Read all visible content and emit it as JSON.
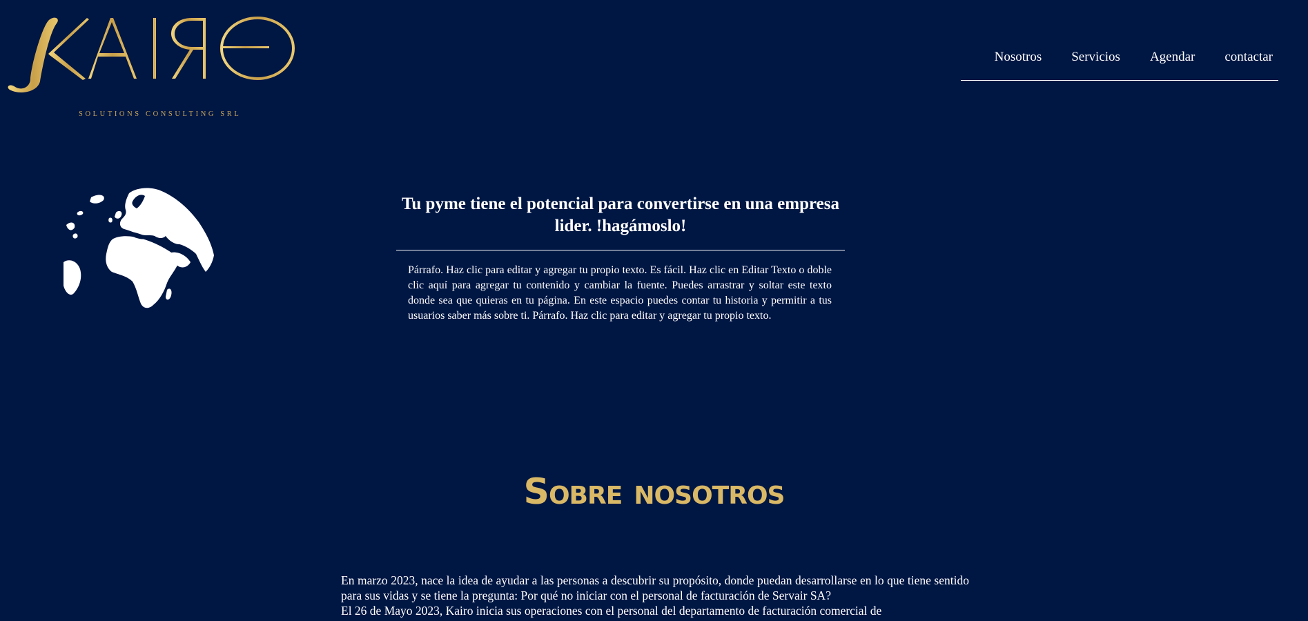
{
  "brand": {
    "logo_text": "KAIRO",
    "tagline": "SOLUTIONS CONSULTING SRL",
    "gold_color": "#c9a85a"
  },
  "nav": {
    "items": [
      {
        "label": "Nosotros"
      },
      {
        "label": "Servicios"
      },
      {
        "label": "Agendar"
      },
      {
        "label": "contactar"
      }
    ]
  },
  "hero": {
    "icon": "globe-icon",
    "title": "Tu pyme tiene el potencial para convertirse en una empresa lider. !hagámoslo!",
    "paragraph": "Párrafo. Haz clic para editar y agregar tu propio texto. Es fácil. Haz clic en Editar Texto o doble clic aquí para agregar tu contenido y cambiar la fuente. Puedes arrastrar y soltar este texto donde sea que quieras en tu página. En este espacio puedes contar tu historia y permitir a tus usuarios saber más sobre ti. Párrafo. Haz clic para editar y agregar tu propio texto."
  },
  "about": {
    "title": "Sobre nosotros",
    "paragraph_1": "En marzo 2023, nace la idea de ayudar a las personas a descubrir su propósito, donde puedan desarrollarse en lo que tiene sentido para sus vidas y se tiene la pregunta: Por qué no iniciar con el personal de facturación de Servair SA?",
    "paragraph_2": "El 26 de Mayo 2023, Kairo inicia sus operaciones con el personal del departamento de facturación comercial de"
  },
  "colors": {
    "background": "#001643",
    "accent_gold": "#d9b866",
    "text": "#ffffff"
  }
}
